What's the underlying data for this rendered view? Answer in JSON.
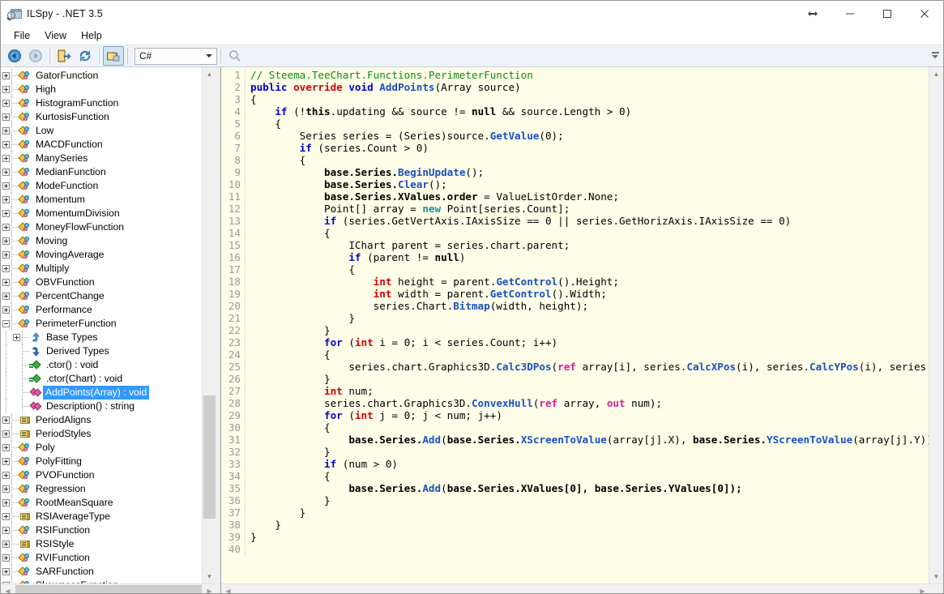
{
  "window": {
    "title": "ILSpy - .NET 3.5",
    "app_icon": "ilspy-icon",
    "buttons": {
      "resize": "resize-horizontal-icon",
      "minimize": "minimize-icon",
      "maximize": "maximize-icon",
      "close": "close-icon"
    }
  },
  "menubar": {
    "items": [
      {
        "label": "File",
        "name": "menu-file"
      },
      {
        "label": "View",
        "name": "menu-view"
      },
      {
        "label": "Help",
        "name": "menu-help"
      }
    ]
  },
  "toolbar": {
    "back": "back-icon",
    "forward": "forward-icon",
    "open": "open-assembly-icon",
    "refresh": "refresh-icon",
    "decompile": "decompile-lock-icon",
    "language": {
      "value": "C#",
      "name": "language-combo"
    },
    "search": "search-icon",
    "overflow": "toolbar-overflow-icon"
  },
  "tree": {
    "selected": "AddPoints(Array) : void",
    "items": [
      {
        "label": "GatorFunction",
        "icon": "class",
        "indent": 0,
        "expander": "plus"
      },
      {
        "label": "High",
        "icon": "class",
        "indent": 0,
        "expander": "plus"
      },
      {
        "label": "HistogramFunction",
        "icon": "class",
        "indent": 0,
        "expander": "plus"
      },
      {
        "label": "KurtosisFunction",
        "icon": "class",
        "indent": 0,
        "expander": "plus"
      },
      {
        "label": "Low",
        "icon": "class",
        "indent": 0,
        "expander": "plus"
      },
      {
        "label": "MACDFunction",
        "icon": "class",
        "indent": 0,
        "expander": "plus"
      },
      {
        "label": "ManySeries",
        "icon": "class",
        "indent": 0,
        "expander": "plus"
      },
      {
        "label": "MedianFunction",
        "icon": "class",
        "indent": 0,
        "expander": "plus"
      },
      {
        "label": "ModeFunction",
        "icon": "class",
        "indent": 0,
        "expander": "plus"
      },
      {
        "label": "Momentum",
        "icon": "class",
        "indent": 0,
        "expander": "plus"
      },
      {
        "label": "MomentumDivision",
        "icon": "class",
        "indent": 0,
        "expander": "plus"
      },
      {
        "label": "MoneyFlowFunction",
        "icon": "class",
        "indent": 0,
        "expander": "plus"
      },
      {
        "label": "Moving",
        "icon": "class",
        "indent": 0,
        "expander": "plus"
      },
      {
        "label": "MovingAverage",
        "icon": "class",
        "indent": 0,
        "expander": "plus"
      },
      {
        "label": "Multiply",
        "icon": "class",
        "indent": 0,
        "expander": "plus"
      },
      {
        "label": "OBVFunction",
        "icon": "class",
        "indent": 0,
        "expander": "plus"
      },
      {
        "label": "PercentChange",
        "icon": "class",
        "indent": 0,
        "expander": "plus"
      },
      {
        "label": "Performance",
        "icon": "class",
        "indent": 0,
        "expander": "plus"
      },
      {
        "label": "PerimeterFunction",
        "icon": "class",
        "indent": 0,
        "expander": "minus"
      },
      {
        "label": "Base Types",
        "icon": "baset",
        "indent": 1,
        "expander": "plus"
      },
      {
        "label": "Derived Types",
        "icon": "derivedt",
        "indent": 1,
        "expander": "none"
      },
      {
        "label": ".ctor() : void",
        "icon": "ctor",
        "indent": 1,
        "expander": "none"
      },
      {
        "label": ".ctor(Chart) : void",
        "icon": "ctor",
        "indent": 1,
        "expander": "none"
      },
      {
        "label": "AddPoints(Array) : void",
        "icon": "method",
        "indent": 1,
        "expander": "none",
        "selected": true
      },
      {
        "label": "Description() : string",
        "icon": "method",
        "indent": 1,
        "expander": "none"
      },
      {
        "label": "PeriodAligns",
        "icon": "enum",
        "indent": 0,
        "expander": "plus"
      },
      {
        "label": "PeriodStyles",
        "icon": "enum",
        "indent": 0,
        "expander": "plus"
      },
      {
        "label": "Poly",
        "icon": "class",
        "indent": 0,
        "expander": "plus"
      },
      {
        "label": "PolyFitting",
        "icon": "class",
        "indent": 0,
        "expander": "plus"
      },
      {
        "label": "PVOFunction",
        "icon": "class",
        "indent": 0,
        "expander": "plus"
      },
      {
        "label": "Regression",
        "icon": "class",
        "indent": 0,
        "expander": "plus"
      },
      {
        "label": "RootMeanSquare",
        "icon": "class",
        "indent": 0,
        "expander": "plus"
      },
      {
        "label": "RSIAverageType",
        "icon": "enum",
        "indent": 0,
        "expander": "plus"
      },
      {
        "label": "RSIFunction",
        "icon": "class",
        "indent": 0,
        "expander": "plus"
      },
      {
        "label": "RSIStyle",
        "icon": "enum",
        "indent": 0,
        "expander": "plus"
      },
      {
        "label": "RVIFunction",
        "icon": "class",
        "indent": 0,
        "expander": "plus"
      },
      {
        "label": "SARFunction",
        "icon": "class",
        "indent": 0,
        "expander": "plus"
      },
      {
        "label": "SkewnessFunction",
        "icon": "class",
        "indent": 0,
        "expander": "plus"
      }
    ]
  },
  "editor": {
    "first_line": 1,
    "last_line": 40,
    "language": "C#",
    "lines": [
      {
        "n": 1,
        "tokens": [
          {
            "t": "// Steema.TeeChart.Functions.PerimeterFunction",
            "c": "cm"
          }
        ]
      },
      {
        "n": 2,
        "tokens": [
          {
            "t": "public ",
            "c": "k"
          },
          {
            "t": "override ",
            "c": "k2"
          },
          {
            "t": "void ",
            "c": "k"
          },
          {
            "t": "AddPoints",
            "c": "mth"
          },
          {
            "t": "(Array source)",
            "c": "nm"
          }
        ]
      },
      {
        "n": 3,
        "tokens": [
          {
            "t": "{",
            "c": "nm"
          }
        ]
      },
      {
        "n": 4,
        "tokens": [
          {
            "t": "    ",
            "c": "nm"
          },
          {
            "t": "if",
            "c": "k"
          },
          {
            "t": " (!",
            "c": "nm"
          },
          {
            "t": "this",
            "c": "bs"
          },
          {
            "t": ".updating && source != ",
            "c": "nm"
          },
          {
            "t": "null",
            "c": "bs"
          },
          {
            "t": " && source.Length > 0)",
            "c": "nm"
          }
        ]
      },
      {
        "n": 5,
        "tokens": [
          {
            "t": "    {",
            "c": "nm"
          }
        ]
      },
      {
        "n": 6,
        "tokens": [
          {
            "t": "        Series series = (Series)source.",
            "c": "nm"
          },
          {
            "t": "GetValue",
            "c": "mth"
          },
          {
            "t": "(0);",
            "c": "nm"
          }
        ]
      },
      {
        "n": 7,
        "tokens": [
          {
            "t": "        ",
            "c": "nm"
          },
          {
            "t": "if",
            "c": "k"
          },
          {
            "t": " (series.Count > 0)",
            "c": "nm"
          }
        ]
      },
      {
        "n": 8,
        "tokens": [
          {
            "t": "        {",
            "c": "nm"
          }
        ]
      },
      {
        "n": 9,
        "tokens": [
          {
            "t": "            ",
            "c": "nm"
          },
          {
            "t": "base",
            "c": "bs"
          },
          {
            "t": ".Series.",
            "c": "bs"
          },
          {
            "t": "BeginUpdate",
            "c": "mth"
          },
          {
            "t": "();",
            "c": "nm"
          }
        ]
      },
      {
        "n": 10,
        "tokens": [
          {
            "t": "            ",
            "c": "nm"
          },
          {
            "t": "base",
            "c": "bs"
          },
          {
            "t": ".Series.",
            "c": "bs"
          },
          {
            "t": "Clear",
            "c": "mth"
          },
          {
            "t": "();",
            "c": "nm"
          }
        ]
      },
      {
        "n": 11,
        "tokens": [
          {
            "t": "            ",
            "c": "nm"
          },
          {
            "t": "base",
            "c": "bs"
          },
          {
            "t": ".Series.XValues.order",
            "c": "bs"
          },
          {
            "t": " = ValueListOrder.None;",
            "c": "nm"
          }
        ]
      },
      {
        "n": 12,
        "tokens": [
          {
            "t": "            Point[] array = ",
            "c": "nm"
          },
          {
            "t": "new",
            "c": "k4"
          },
          {
            "t": " Point[series.Count];",
            "c": "nm"
          }
        ]
      },
      {
        "n": 13,
        "tokens": [
          {
            "t": "            ",
            "c": "nm"
          },
          {
            "t": "if",
            "c": "k"
          },
          {
            "t": " (series.GetVertAxis.IAxisSize == 0 || series.GetHorizAxis.IAxisSize == 0)",
            "c": "nm"
          }
        ]
      },
      {
        "n": 14,
        "tokens": [
          {
            "t": "            {",
            "c": "nm"
          }
        ]
      },
      {
        "n": 15,
        "tokens": [
          {
            "t": "                IChart parent = series.chart.parent;",
            "c": "nm"
          }
        ]
      },
      {
        "n": 16,
        "tokens": [
          {
            "t": "                ",
            "c": "nm"
          },
          {
            "t": "if",
            "c": "k"
          },
          {
            "t": " (parent != ",
            "c": "nm"
          },
          {
            "t": "null",
            "c": "bs"
          },
          {
            "t": ")",
            "c": "nm"
          }
        ]
      },
      {
        "n": 17,
        "tokens": [
          {
            "t": "                {",
            "c": "nm"
          }
        ]
      },
      {
        "n": 18,
        "tokens": [
          {
            "t": "                    ",
            "c": "nm"
          },
          {
            "t": "int",
            "c": "k2"
          },
          {
            "t": " height = parent.",
            "c": "nm"
          },
          {
            "t": "GetControl",
            "c": "mth"
          },
          {
            "t": "().Height;",
            "c": "nm"
          }
        ]
      },
      {
        "n": 19,
        "tokens": [
          {
            "t": "                    ",
            "c": "nm"
          },
          {
            "t": "int",
            "c": "k2"
          },
          {
            "t": " width = parent.",
            "c": "nm"
          },
          {
            "t": "GetControl",
            "c": "mth"
          },
          {
            "t": "().Width;",
            "c": "nm"
          }
        ]
      },
      {
        "n": 20,
        "tokens": [
          {
            "t": "                    series.Chart.",
            "c": "nm"
          },
          {
            "t": "Bitmap",
            "c": "mth"
          },
          {
            "t": "(width, height);",
            "c": "nm"
          }
        ]
      },
      {
        "n": 21,
        "tokens": [
          {
            "t": "                }",
            "c": "nm"
          }
        ]
      },
      {
        "n": 22,
        "tokens": [
          {
            "t": "            }",
            "c": "nm"
          }
        ]
      },
      {
        "n": 23,
        "tokens": [
          {
            "t": "            ",
            "c": "nm"
          },
          {
            "t": "for",
            "c": "k"
          },
          {
            "t": " (",
            "c": "nm"
          },
          {
            "t": "int",
            "c": "k2"
          },
          {
            "t": " i = 0; i < series.Count; i++)",
            "c": "nm"
          }
        ]
      },
      {
        "n": 24,
        "tokens": [
          {
            "t": "            {",
            "c": "nm"
          }
        ]
      },
      {
        "n": 25,
        "tokens": [
          {
            "t": "                series.chart.Graphics3D.",
            "c": "nm"
          },
          {
            "t": "Calc3DPos",
            "c": "mth"
          },
          {
            "t": "(",
            "c": "nm"
          },
          {
            "t": "ref",
            "c": "k3"
          },
          {
            "t": " array[i], series.",
            "c": "nm"
          },
          {
            "t": "CalcXPos",
            "c": "mth"
          },
          {
            "t": "(i), series.",
            "c": "nm"
          },
          {
            "t": "CalcYPos",
            "c": "mth"
          },
          {
            "t": "(i), series.MiddleZ);",
            "c": "nm"
          }
        ]
      },
      {
        "n": 26,
        "tokens": [
          {
            "t": "            }",
            "c": "nm"
          }
        ]
      },
      {
        "n": 27,
        "tokens": [
          {
            "t": "            ",
            "c": "nm"
          },
          {
            "t": "int",
            "c": "k2"
          },
          {
            "t": " num;",
            "c": "nm"
          }
        ]
      },
      {
        "n": 28,
        "tokens": [
          {
            "t": "            series.chart.Graphics3D.",
            "c": "nm"
          },
          {
            "t": "ConvexHull",
            "c": "mth"
          },
          {
            "t": "(",
            "c": "nm"
          },
          {
            "t": "ref",
            "c": "k3"
          },
          {
            "t": " array, ",
            "c": "nm"
          },
          {
            "t": "out",
            "c": "k3"
          },
          {
            "t": " num);",
            "c": "nm"
          }
        ]
      },
      {
        "n": 29,
        "tokens": [
          {
            "t": "            ",
            "c": "nm"
          },
          {
            "t": "for",
            "c": "k"
          },
          {
            "t": " (",
            "c": "nm"
          },
          {
            "t": "int",
            "c": "k2"
          },
          {
            "t": " j = 0; j < num; j++)",
            "c": "nm"
          }
        ]
      },
      {
        "n": 30,
        "tokens": [
          {
            "t": "            {",
            "c": "nm"
          }
        ]
      },
      {
        "n": 31,
        "tokens": [
          {
            "t": "                ",
            "c": "nm"
          },
          {
            "t": "base",
            "c": "bs"
          },
          {
            "t": ".Series.",
            "c": "bs"
          },
          {
            "t": "Add",
            "c": "mth"
          },
          {
            "t": "(",
            "c": "nm"
          },
          {
            "t": "base",
            "c": "bs"
          },
          {
            "t": ".Series.",
            "c": "bs"
          },
          {
            "t": "XScreenToValue",
            "c": "mth"
          },
          {
            "t": "(array[j].X), ",
            "c": "nm"
          },
          {
            "t": "base",
            "c": "bs"
          },
          {
            "t": ".Series.",
            "c": "bs"
          },
          {
            "t": "YScreenToValue",
            "c": "mth"
          },
          {
            "t": "(array[j].Y));",
            "c": "nm"
          }
        ]
      },
      {
        "n": 32,
        "tokens": [
          {
            "t": "            }",
            "c": "nm"
          }
        ]
      },
      {
        "n": 33,
        "tokens": [
          {
            "t": "            ",
            "c": "nm"
          },
          {
            "t": "if",
            "c": "k"
          },
          {
            "t": " (num > 0)",
            "c": "nm"
          }
        ]
      },
      {
        "n": 34,
        "tokens": [
          {
            "t": "            {",
            "c": "nm"
          }
        ]
      },
      {
        "n": 35,
        "tokens": [
          {
            "t": "                ",
            "c": "nm"
          },
          {
            "t": "base",
            "c": "bs"
          },
          {
            "t": ".Series.",
            "c": "bs"
          },
          {
            "t": "Add",
            "c": "mth"
          },
          {
            "t": "(",
            "c": "nm"
          },
          {
            "t": "base",
            "c": "bs"
          },
          {
            "t": ".Series.XValues[0], ",
            "c": "bs"
          },
          {
            "t": "base",
            "c": "bs"
          },
          {
            "t": ".Series.YValues[0]);",
            "c": "bs"
          }
        ]
      },
      {
        "n": 36,
        "tokens": [
          {
            "t": "            }",
            "c": "nm"
          }
        ]
      },
      {
        "n": 37,
        "tokens": [
          {
            "t": "        }",
            "c": "nm"
          }
        ]
      },
      {
        "n": 38,
        "tokens": [
          {
            "t": "    }",
            "c": "nm"
          }
        ]
      },
      {
        "n": 39,
        "tokens": [
          {
            "t": "}",
            "c": "nm"
          }
        ]
      },
      {
        "n": 40,
        "tokens": [
          {
            "t": "",
            "c": "nm"
          }
        ]
      }
    ]
  },
  "colors": {
    "code_background": "#fefde8",
    "selection": "#3399ff",
    "comment": "#0f8a0f",
    "keyword": "#0000d0",
    "keyword_type": "#d00000",
    "keyword_modifier": "#e0179e",
    "method": "#1a4fbf",
    "toolbar_background": "#eff3f7"
  }
}
